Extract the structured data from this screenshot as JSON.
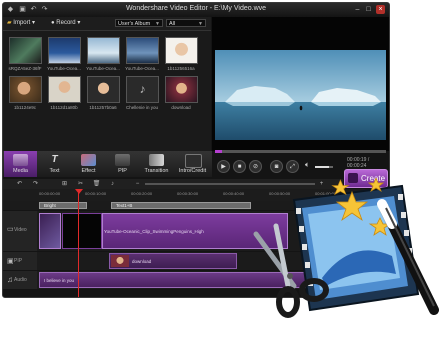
{
  "window": {
    "title": "Wondershare Video Editor - E:\\My Video.wve"
  },
  "toolbar": {
    "import_label": "Import",
    "record_label": "Record",
    "album_select": "User's Album",
    "filter_select": "All"
  },
  "library": {
    "items": [
      {
        "label": "sRQZA5eZ-36fF",
        "icon": "video-thumbnail"
      },
      {
        "label": "YouTube-Ocea...",
        "icon": "video-thumbnail"
      },
      {
        "label": "YouTube-Ocea...",
        "icon": "video-thumbnail"
      },
      {
        "label": "YouTube-Ocea...",
        "icon": "video-thumbnail"
      },
      {
        "label": "1b11256516a",
        "icon": "photo-thumbnail"
      },
      {
        "label": "1b1124e9c",
        "icon": "photo-thumbnail"
      },
      {
        "label": "1b112d1a80b",
        "icon": "photo-thumbnail"
      },
      {
        "label": "1b11257b0a6",
        "icon": "photo-thumbnail"
      },
      {
        "label": "Chellenie in you",
        "icon": "audio-thumbnail"
      },
      {
        "label": "download",
        "icon": "photo-thumbnail"
      }
    ]
  },
  "tabs": [
    {
      "label": "Media",
      "icon": "media-icon",
      "active": true
    },
    {
      "label": "Text",
      "icon": "text-icon",
      "active": false
    },
    {
      "label": "Effect",
      "icon": "effect-icon",
      "active": false
    },
    {
      "label": "PIP",
      "icon": "pip-icon",
      "active": false
    },
    {
      "label": "Transition",
      "icon": "transition-icon",
      "active": false
    },
    {
      "label": "Intro/Credit",
      "icon": "intro-credit-icon",
      "active": false
    }
  ],
  "player": {
    "time": "00:00:19 / 00:00:24",
    "progress": 0.04,
    "volume": 0.75
  },
  "create_button": {
    "label": "Create"
  },
  "timeline": {
    "ticks": [
      "00:00:00:00",
      "00:00:10:00",
      "00:00:20:00",
      "00:00:30:00",
      "00:00:40:00",
      "00:00:50:00",
      "00:01:00:00",
      "00:01:10:00"
    ],
    "tracks": [
      {
        "label": "Video",
        "icon": "video-track-icon"
      },
      {
        "label": "PIP",
        "icon": "pip-track-icon"
      },
      {
        "label": "Audio",
        "icon": "music-note-icon"
      }
    ],
    "text_clips": [
      "Bright",
      "Text1+B"
    ],
    "video_clip": "YouTube-Oceanic_Clip_SwimmingPenguins_High",
    "pip_clip": "download",
    "audio_clip": "I believe in you"
  },
  "colors": {
    "accent": "#8a3fb0",
    "playhead": "#e12a2a",
    "window_bg": "#141414"
  }
}
